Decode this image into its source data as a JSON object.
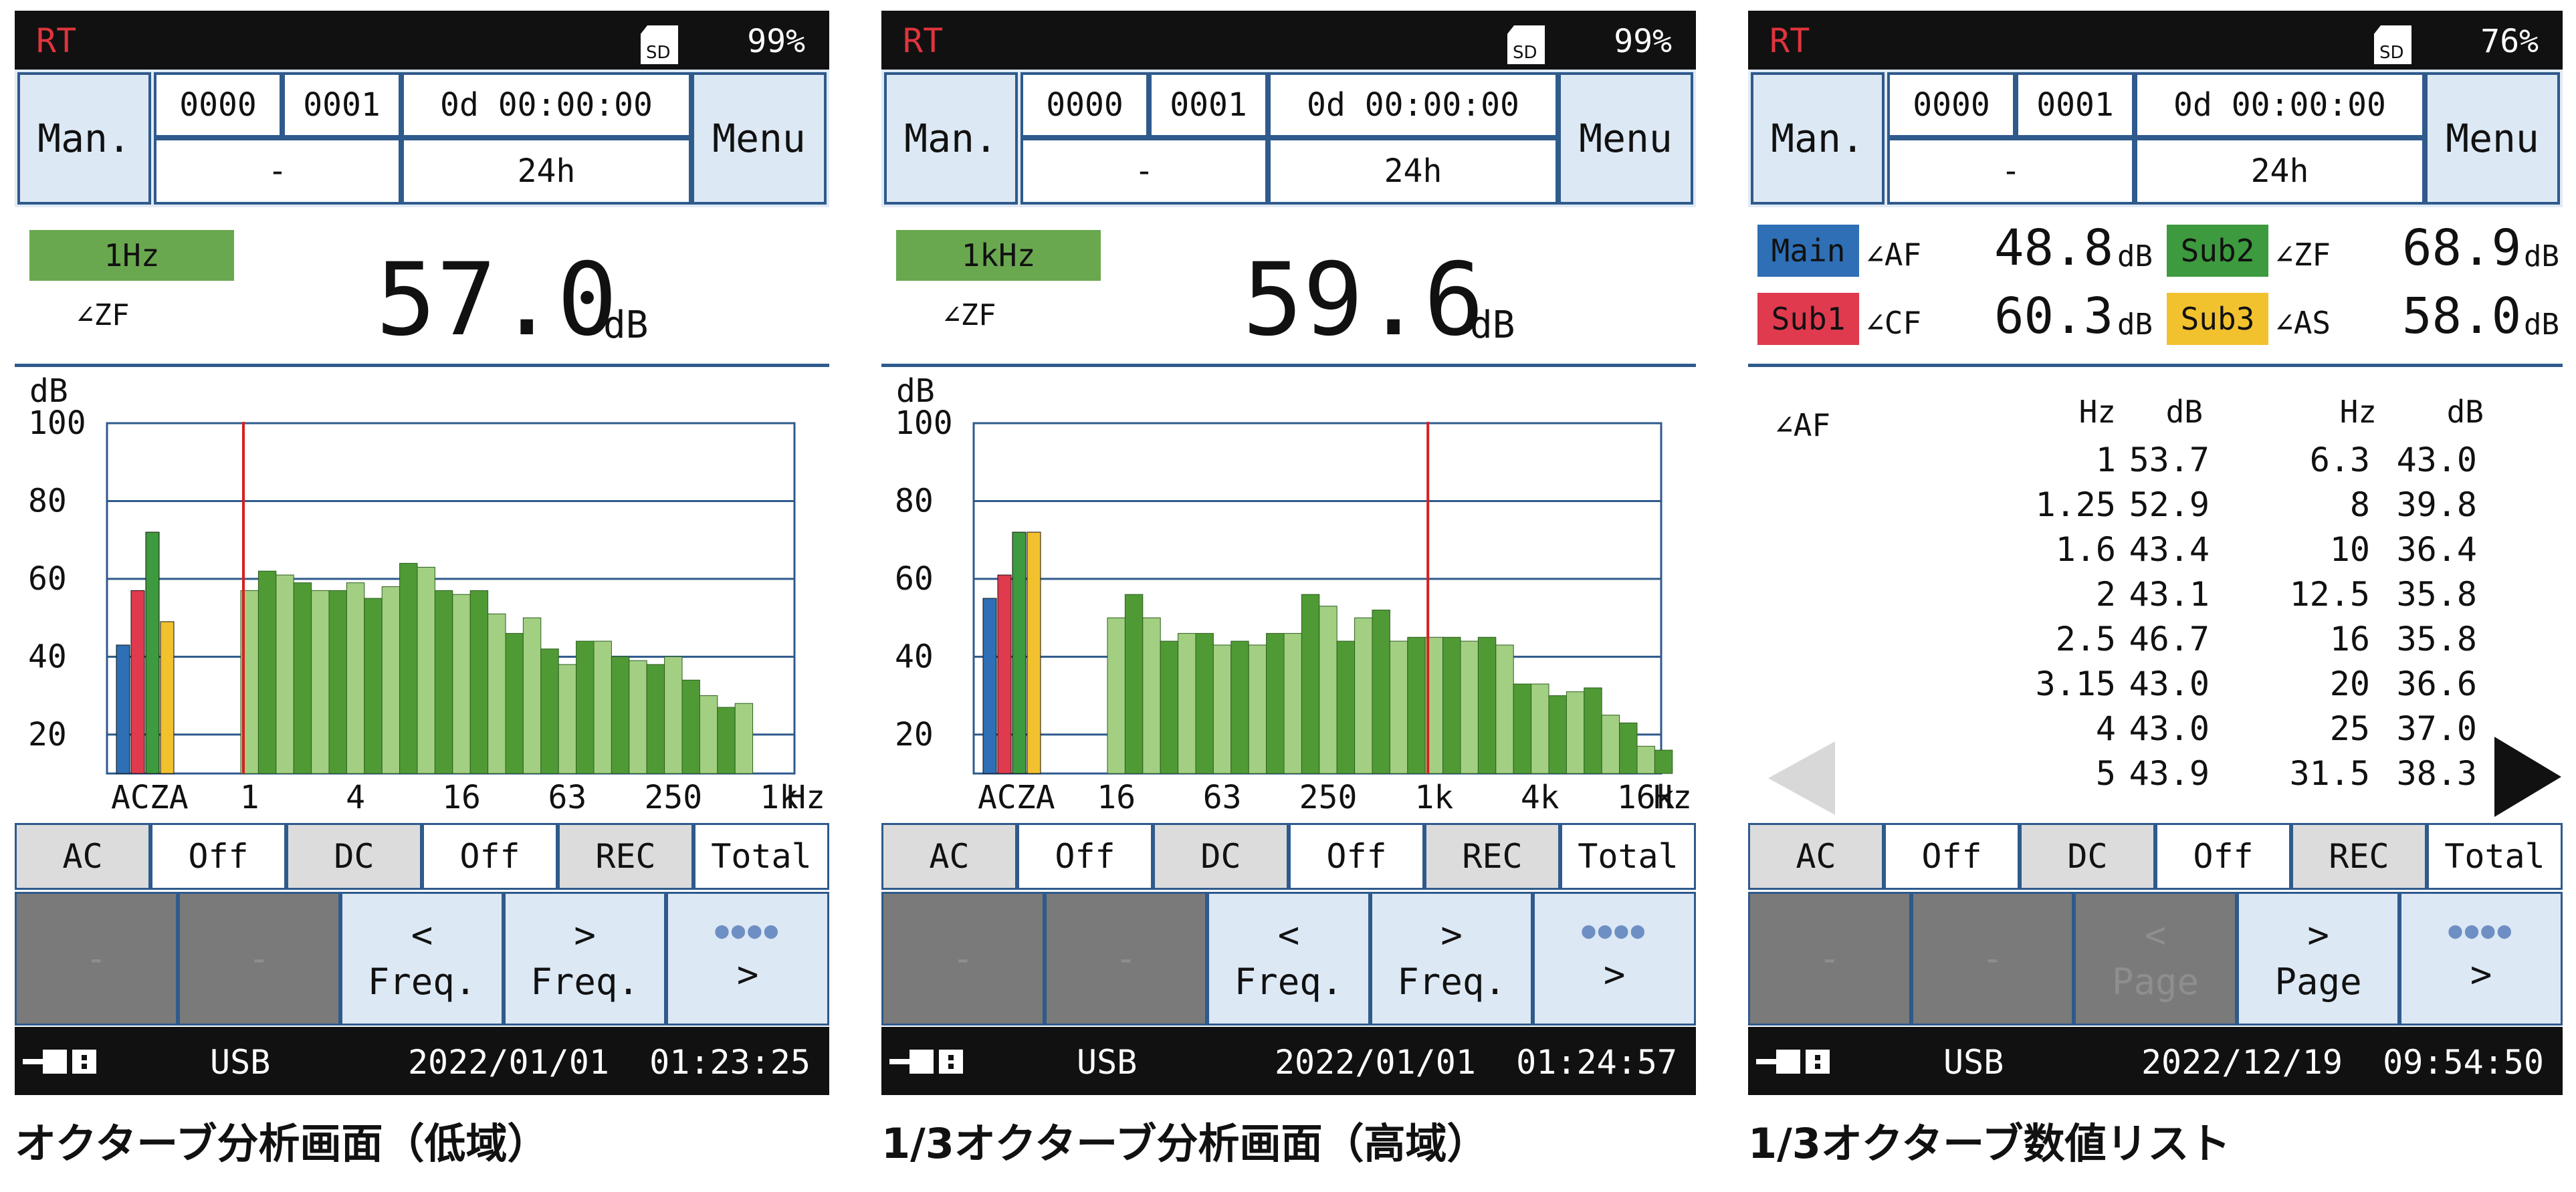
{
  "screens": [
    {
      "status_top": {
        "mode": "RT",
        "sd_label": "SD",
        "battery": "99%"
      },
      "header": {
        "left_button": "Man.",
        "right_button": "Menu",
        "cells": {
          "c1": "0000",
          "c2": "0001",
          "elapsed": "0d 00:00:00",
          "c4": "-",
          "period": "24h"
        }
      },
      "measurement": {
        "band": "1Hz",
        "weighting": "∠ZF",
        "value": "57.0",
        "unit": "dB"
      },
      "status_row": {
        "ac_label": "AC",
        "ac_value": "Off",
        "dc_label": "DC",
        "dc_value": "Off",
        "rec_label": "REC",
        "rec_value": "Total"
      },
      "function_keys": {
        "f1": "-",
        "f2": "-",
        "f3_top": "<",
        "f3_bottom": "Freq.",
        "f4_top": ">",
        "f4_bottom": "Freq.",
        "f5_dots": "●●●●",
        "f5_label": ">"
      },
      "footer": {
        "port": "USB",
        "datetime": "2022/01/01  01:23:25"
      },
      "caption": "オクターブ分析画面（低域）",
      "chart_data": {
        "type": "bar",
        "ylabel": "dB",
        "ylim": [
          10,
          100
        ],
        "yticks": [
          "100",
          "80",
          "60",
          "40",
          "20"
        ],
        "xticks": [
          "ACZA",
          "1",
          "4",
          "16",
          "63",
          "250",
          "1k"
        ],
        "x_unit": "Hz",
        "overall_bars": [
          {
            "name": "A",
            "value": 43,
            "color": "#2e6fb5"
          },
          {
            "name": "C",
            "value": 57,
            "color": "#e03a4e"
          },
          {
            "name": "Z",
            "value": 72,
            "color": "#3d9a3f"
          },
          {
            "name": "A",
            "value": 49,
            "color": "#f2c12e"
          }
        ],
        "band_values": [
          57,
          62,
          61,
          59,
          57,
          57,
          59,
          55,
          58,
          64,
          63,
          57,
          56,
          57,
          51,
          46,
          50,
          42,
          38,
          44,
          44,
          40,
          39,
          38,
          40,
          34,
          30,
          27,
          28
        ],
        "band_tick_positions": {
          "1": 0,
          "4": 6,
          "16": 12,
          "63": 18,
          "250": 24,
          "1k": 30
        },
        "cursor_band": 0
      }
    },
    {
      "status_top": {
        "mode": "RT",
        "sd_label": "SD",
        "battery": "99%"
      },
      "header": {
        "left_button": "Man.",
        "right_button": "Menu",
        "cells": {
          "c1": "0000",
          "c2": "0001",
          "elapsed": "0d 00:00:00",
          "c4": "-",
          "period": "24h"
        }
      },
      "measurement": {
        "band": "1kHz",
        "weighting": "∠ZF",
        "value": "59.6",
        "unit": "dB"
      },
      "status_row": {
        "ac_label": "AC",
        "ac_value": "Off",
        "dc_label": "DC",
        "dc_value": "Off",
        "rec_label": "REC",
        "rec_value": "Total"
      },
      "function_keys": {
        "f1": "-",
        "f2": "-",
        "f3_top": "<",
        "f3_bottom": "Freq.",
        "f4_top": ">",
        "f4_bottom": "Freq.",
        "f5_dots": "●●●●",
        "f5_label": ">"
      },
      "footer": {
        "port": "USB",
        "datetime": "2022/01/01  01:24:57"
      },
      "caption": "1/3オクターブ分析画面（高域）",
      "chart_data": {
        "type": "bar",
        "ylabel": "dB",
        "ylim": [
          10,
          100
        ],
        "yticks": [
          "100",
          "80",
          "60",
          "40",
          "20"
        ],
        "xticks": [
          "ACZA",
          "16",
          "63",
          "250",
          "1k",
          "4k",
          "16k"
        ],
        "x_unit": "Hz",
        "overall_bars": [
          {
            "name": "A",
            "value": 55,
            "color": "#2e6fb5"
          },
          {
            "name": "C",
            "value": 61,
            "color": "#e03a4e"
          },
          {
            "name": "Z",
            "value": 72,
            "color": "#3d9a3f"
          },
          {
            "name": "A",
            "value": 72,
            "color": "#f2c12e"
          }
        ],
        "band_values": [
          50,
          56,
          50,
          44,
          46,
          46,
          43,
          44,
          43,
          46,
          46,
          56,
          53,
          44,
          50,
          52,
          44,
          45,
          45,
          45,
          44,
          45,
          43,
          33,
          33,
          30,
          31,
          32,
          25,
          23,
          17,
          16
        ],
        "band_tick_positions": {
          "16": 0,
          "63": 6,
          "250": 12,
          "1k": 18,
          "4k": 24,
          "16k": 30
        },
        "cursor_band": 18
      }
    },
    {
      "status_top": {
        "mode": "RT",
        "sd_label": "SD",
        "battery": "76%"
      },
      "header": {
        "left_button": "Man.",
        "right_button": "Menu",
        "cells": {
          "c1": "0000",
          "c2": "0001",
          "elapsed": "0d 00:00:00",
          "c4": "-",
          "period": "24h"
        }
      },
      "readings": [
        {
          "tag": "Main",
          "weighting": "∠AF",
          "value": "48.8",
          "unit": "dB",
          "color": "#2e6fb5"
        },
        {
          "tag": "Sub2",
          "weighting": "∠ZF",
          "value": "68.9",
          "unit": "dB",
          "color": "#3d9a3f"
        },
        {
          "tag": "Sub1",
          "weighting": "∠CF",
          "value": "60.3",
          "unit": "dB",
          "color": "#e03a4e"
        },
        {
          "tag": "Sub3",
          "weighting": "∠AS",
          "value": "58.0",
          "unit": "dB",
          "color": "#f2c12e"
        }
      ],
      "table": {
        "weighting": "∠AF",
        "headers": [
          "Hz",
          "dB",
          "Hz",
          "dB"
        ],
        "hz1": "1\n1.25\n1.6\n2\n2.5\n3.15\n4\n5",
        "db1": "53.7\n52.9\n43.4\n43.1\n46.7\n43.0\n43.0\n43.9",
        "hz2": "6.3\n8\n10\n12.5\n16\n20\n25\n31.5",
        "db2": "43.0\n39.8\n36.4\n35.8\n35.8\n36.6\n37.0\n38.3"
      },
      "status_row": {
        "ac_label": "AC",
        "ac_value": "Off",
        "dc_label": "DC",
        "dc_value": "Off",
        "rec_label": "REC",
        "rec_value": "Total"
      },
      "function_keys": {
        "f1": "-",
        "f2": "-",
        "f3_top": "<",
        "f3_bottom": "Page",
        "f4_top": ">",
        "f4_bottom": "Page",
        "f5_dots": "●●●●",
        "f5_label": ">"
      },
      "footer": {
        "port": "USB",
        "datetime": "2022/12/19  09:54:50"
      },
      "caption": "1/3オクターブ数値リスト"
    }
  ]
}
